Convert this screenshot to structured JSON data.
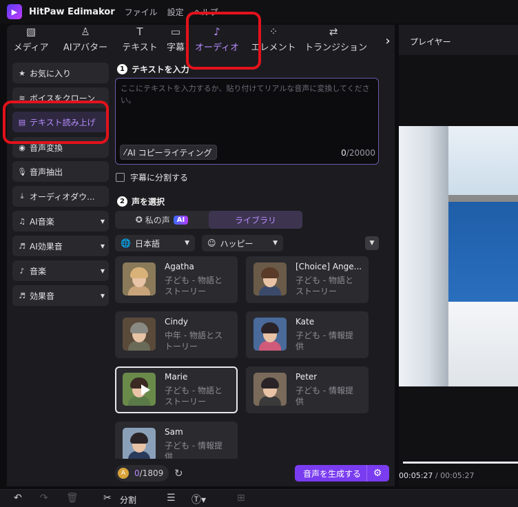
{
  "app": {
    "title": "HitPaw Edimakor",
    "logo_icon": "play-logo-icon",
    "menu": [
      "ファイル",
      "設定",
      "ヘルプ"
    ]
  },
  "tools": [
    {
      "label": "メディア",
      "icon": "image-icon"
    },
    {
      "label": "AIアバター",
      "icon": "avatar-plus-icon"
    },
    {
      "label": "テキスト",
      "icon": "text-icon"
    },
    {
      "label": "字幕",
      "icon": "subtitle-icon"
    },
    {
      "label": "オーディオ",
      "icon": "music-note-icon",
      "active": true
    },
    {
      "label": "エレメント",
      "icon": "elements-icon"
    },
    {
      "label": "トランジション",
      "icon": "transition-icon"
    }
  ],
  "sidebar": {
    "items": [
      {
        "label": "お気に入り",
        "icon": "star-icon"
      },
      {
        "label": "ボイスをクローン",
        "icon": "waveform-icon"
      },
      {
        "label": "テキスト読み上げ",
        "icon": "text-to-speech-icon",
        "active": true
      },
      {
        "label": "音声変換",
        "icon": "voice-change-icon"
      },
      {
        "label": "音声抽出",
        "icon": "microphone-icon"
      },
      {
        "label": "オーディオダウ...",
        "icon": "download-icon"
      },
      {
        "label": "AI音楽",
        "icon": "ai-music-icon",
        "has_dropdown": true
      },
      {
        "label": "AI効果音",
        "icon": "ai-sfx-icon",
        "has_dropdown": true
      },
      {
        "label": "音楽",
        "icon": "music-note-icon",
        "has_dropdown": true
      },
      {
        "label": "効果音",
        "icon": "sfx-icon",
        "has_dropdown": true
      }
    ]
  },
  "text_input": {
    "step": "1",
    "heading": "テキストを入力",
    "placeholder": "ここにテキストを入力するか、貼り付けてリアルな音声に変換してください。",
    "copywriting_button": "AI コピーライティング",
    "char_used": "0",
    "char_limit": "/20000",
    "split_subtitles_label": "字幕に分割する",
    "split_subtitles_checked": false
  },
  "voice_select": {
    "step": "2",
    "heading": "声を選択",
    "tabs": [
      {
        "label": "私の声",
        "badge": "AI"
      },
      {
        "label": "ライブラリ",
        "active": true
      }
    ],
    "language": "日本語",
    "emotion": "ハッピー",
    "voices": [
      {
        "name": "Agatha",
        "desc": "子ども - 物語とストーリー",
        "hair": "#d9b27a",
        "clothes": "#c9a37a",
        "bg": "#8a7a5a"
      },
      {
        "name": "[Choice] Ange...",
        "desc": "子ども - 物語とストーリー",
        "hair": "#5a3a28",
        "clothes": "#3b4a6a",
        "bg": "#6a5a48"
      },
      {
        "name": "Cindy",
        "desc": "中年 - 物語とストーリー",
        "hair": "#8a8a84",
        "clothes": "#6a6a58",
        "bg": "#5a4a3a"
      },
      {
        "name": "Kate",
        "desc": "子ども - 情報提供",
        "hair": "#2a2428",
        "clothes": "#d05a7a",
        "bg": "#4a6a9a"
      },
      {
        "name": "Marie",
        "desc": "子ども - 物語とストーリー",
        "hair": "#3a2a22",
        "clothes": "#5a7a48",
        "bg": "#6a8a4a",
        "selected": true
      },
      {
        "name": "Peter",
        "desc": "子ども - 情報提供",
        "hair": "#2a2428",
        "clothes": "#3a3a3a",
        "bg": "#7a6a5a"
      },
      {
        "name": "Sam",
        "desc": "子ども - 情報提供",
        "hair": "#2a2428",
        "clothes": "#2a3a5a",
        "bg": "#8aa0b8"
      }
    ]
  },
  "footer": {
    "credits_used": "0",
    "credits_total": "/1809",
    "generate_button": "音声を生成する"
  },
  "player": {
    "title": "プレイヤー",
    "current_time": "00:05:27",
    "total_time": "00:05:27"
  },
  "bottom_toolbar": {
    "split_label": "分割"
  },
  "colors": {
    "accent": "#b98cff",
    "generate": "#7a3cf0",
    "annotation": "#e3121b"
  }
}
